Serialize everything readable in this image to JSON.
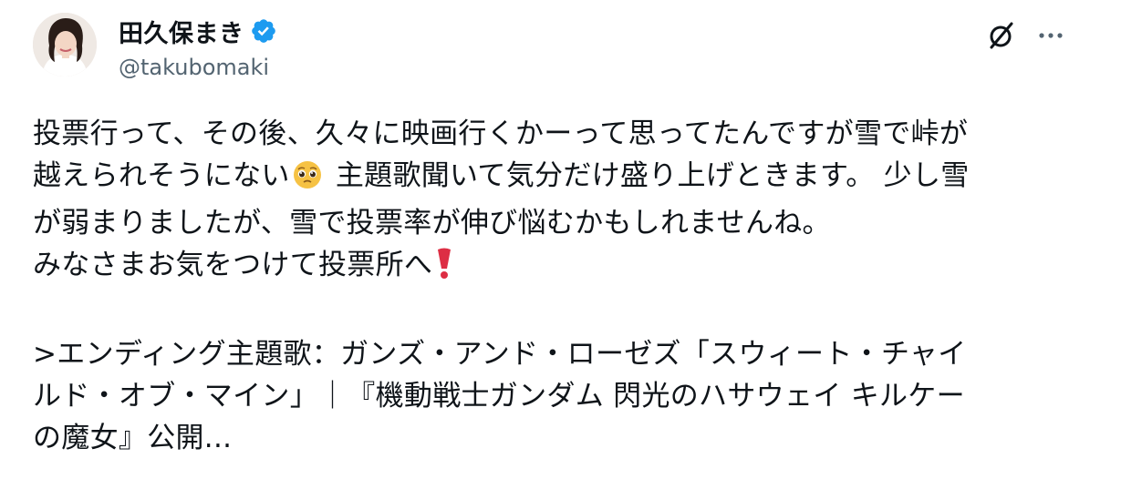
{
  "author": {
    "display_name": "田久保まき",
    "handle": "@takubomaki",
    "verified": true,
    "verified_color": "#1d9bf0"
  },
  "header_actions": {
    "grok_icon": "grok-icon",
    "more_icon": "more-icon"
  },
  "post": {
    "line1": "投票行って、その後、久々に映画行くかーって思ってたんですが雪で峠が",
    "line2_pre": "越えられそうにない",
    "line2_emoji": "pleading-face-emoji",
    "line2_post": " 主題歌聞いて気分だけ盛り上げときます。 少し雪",
    "line3": "が弱まりましたが、雪で投票率が伸び悩むかもしれませんね。",
    "line4_pre": "みなさまお気をつけて投票所へ",
    "line4_emoji": "red-exclamation-emoji",
    "line5": ">エンディング主題歌：ガンズ・アンド・ローゼズ「スウィート・チャイ",
    "line6": "ルド・オブ・マイン」｜『機動戦士ガンダム 閃光のハサウェイ キルケー",
    "line7": "の魔女』公開..."
  },
  "colors": {
    "text": "#0f1419",
    "secondary": "#536471",
    "accent": "#1d9bf0"
  }
}
